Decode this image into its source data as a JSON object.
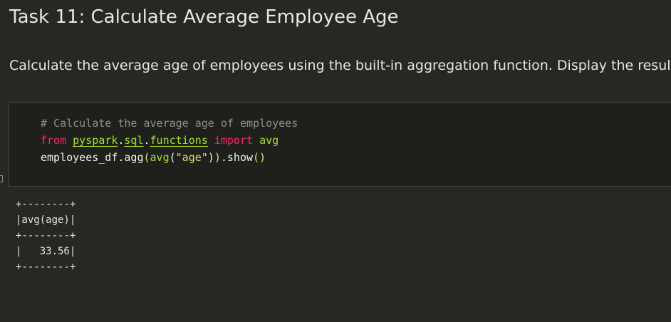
{
  "markdown": {
    "title": "Task 11: Calculate Average Employee Age",
    "description": "Calculate the average age of employees using the built-in aggregation function. Display the result."
  },
  "code_cell": {
    "comment": "# Calculate the average age of employees",
    "line2": {
      "kw_from": "from",
      "mod_pyspark": "pyspark",
      "dot1": ".",
      "mod_sql": "sql",
      "dot2": ".",
      "mod_functions": "functions",
      "kw_import": "import",
      "name_avg": "avg"
    },
    "line3": {
      "obj": "employees_df.agg",
      "open1": "(",
      "fn_avg": "avg",
      "open2": "(",
      "str_age": "\"age\"",
      "close2": ")",
      "close1": ")",
      "method": ".show",
      "call": "()"
    }
  },
  "output": {
    "lines": [
      "+--------+",
      "|avg(age)|",
      "+--------+",
      "|   33.56|",
      "+--------+"
    ]
  },
  "colors": {
    "background": "#272822",
    "code_background": "#1f201c",
    "keyword": "#f92672",
    "function": "#a6e22e",
    "string": "#e6db74",
    "comment": "#8e8e86"
  }
}
